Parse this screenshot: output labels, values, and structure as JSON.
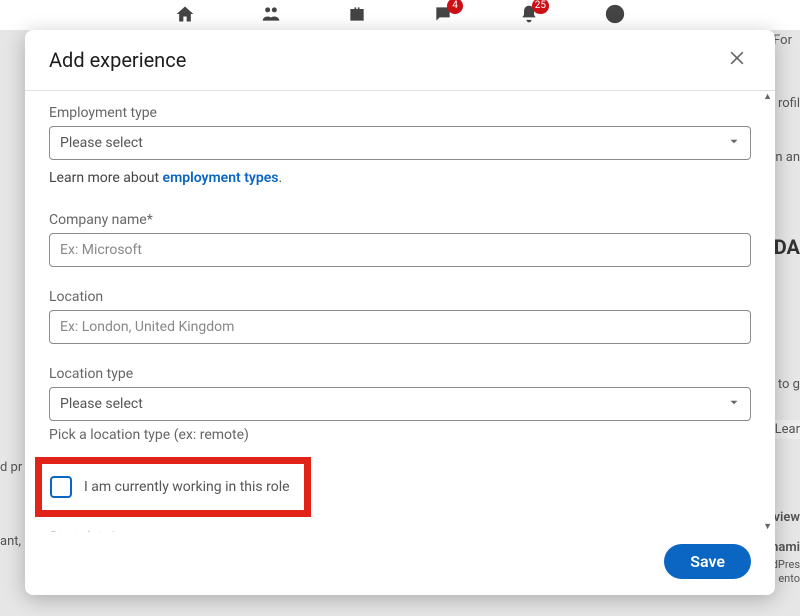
{
  "nav": {
    "badges": {
      "messaging": "4",
      "notifications": "25"
    }
  },
  "bg": {
    "for": "For",
    "profil": "rofil",
    "nan": "n an",
    "da": "DA",
    "tog": "to g",
    "lear": "Lear",
    "dpr": "d pr",
    "ant": "ant,",
    "view": "view",
    "nam": "nami",
    "dpres": "dPres",
    "ento": "ento"
  },
  "modal": {
    "title": "Add experience",
    "employment_type": {
      "label": "Employment type",
      "selected": "Please select"
    },
    "learn_more": {
      "prefix": "Learn more about ",
      "link": "employment types"
    },
    "company": {
      "label": "Company name*",
      "placeholder": "Ex: Microsoft"
    },
    "location": {
      "label": "Location",
      "placeholder": "Ex: London, United Kingdom"
    },
    "location_type": {
      "label": "Location type",
      "selected": "Please select",
      "helper": "Pick a location type (ex: remote)"
    },
    "currently_working": {
      "label": "I am currently working in this role"
    },
    "start_date_label": "Start date*",
    "save_label": "Save"
  }
}
